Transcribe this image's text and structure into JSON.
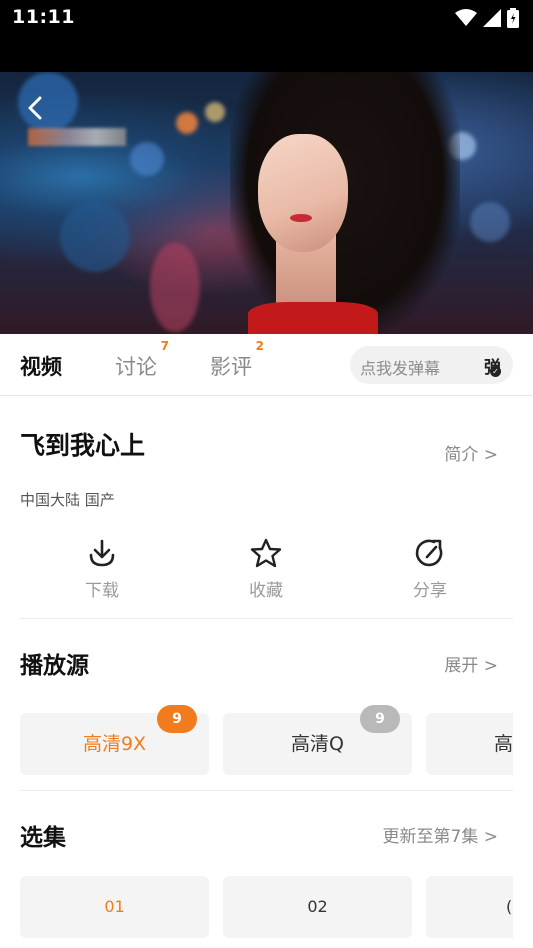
{
  "status_bar": {
    "time": "11:11"
  },
  "player": {
    "title_blurred": ""
  },
  "tabs": [
    {
      "label": "视频",
      "badge": ""
    },
    {
      "label": "讨论",
      "badge": "7"
    },
    {
      "label": "影评",
      "badge": "2"
    }
  ],
  "danmu": {
    "placeholder": "点我发弹幕",
    "button": "弹"
  },
  "show": {
    "title": "飞到我心上",
    "intro_link": "简介 >",
    "meta": "中国大陆  国产"
  },
  "actions": [
    {
      "label": "下载",
      "icon": "download-icon"
    },
    {
      "label": "收藏",
      "icon": "star-icon"
    },
    {
      "label": "分享",
      "icon": "share-icon"
    }
  ],
  "sources": {
    "title": "播放源",
    "expand_link": "展开 >",
    "items": [
      {
        "label": "高清9X",
        "badge": "9",
        "badge_color": "#f07c1e",
        "selected": true
      },
      {
        "label": "高清Q",
        "badge": "9",
        "badge_color": "#b9b9b9",
        "selected": false
      },
      {
        "label": "高",
        "badge": "",
        "badge_color": "",
        "selected": false
      }
    ]
  },
  "episodes": {
    "title": "选集",
    "update_link": "更新至第7集 >",
    "items": [
      {
        "label": "01",
        "selected": true
      },
      {
        "label": "02",
        "selected": false
      },
      {
        "label": "(",
        "selected": false
      }
    ]
  },
  "colors": {
    "accent": "#f07c1e",
    "muted": "#8a8a8a"
  }
}
